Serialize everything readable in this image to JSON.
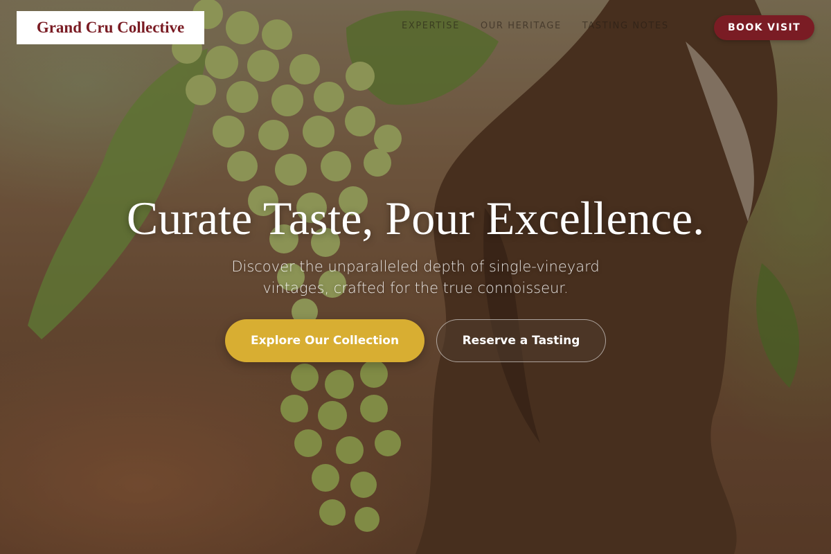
{
  "brand": {
    "name": "Grand Cru Collective",
    "color": "#7a1c24"
  },
  "nav": {
    "links": [
      "EXPERTISE",
      "OUR HERITAGE",
      "TASTING NOTES"
    ],
    "cta": "BOOK VISIT"
  },
  "hero": {
    "title": "Curate Taste, Pour Excellence.",
    "subtitle": "Discover the unparalleled depth of single-vineyard vintages, crafted for the true connoisseur.",
    "primary_cta": "Explore Our Collection",
    "secondary_cta": "Reserve a Tasting",
    "background": "vineyard-grape-vine-photo"
  },
  "colors": {
    "accent_gold": "#d8ae32",
    "wine_red": "#7a1c24",
    "text_light": "#ffffff"
  }
}
